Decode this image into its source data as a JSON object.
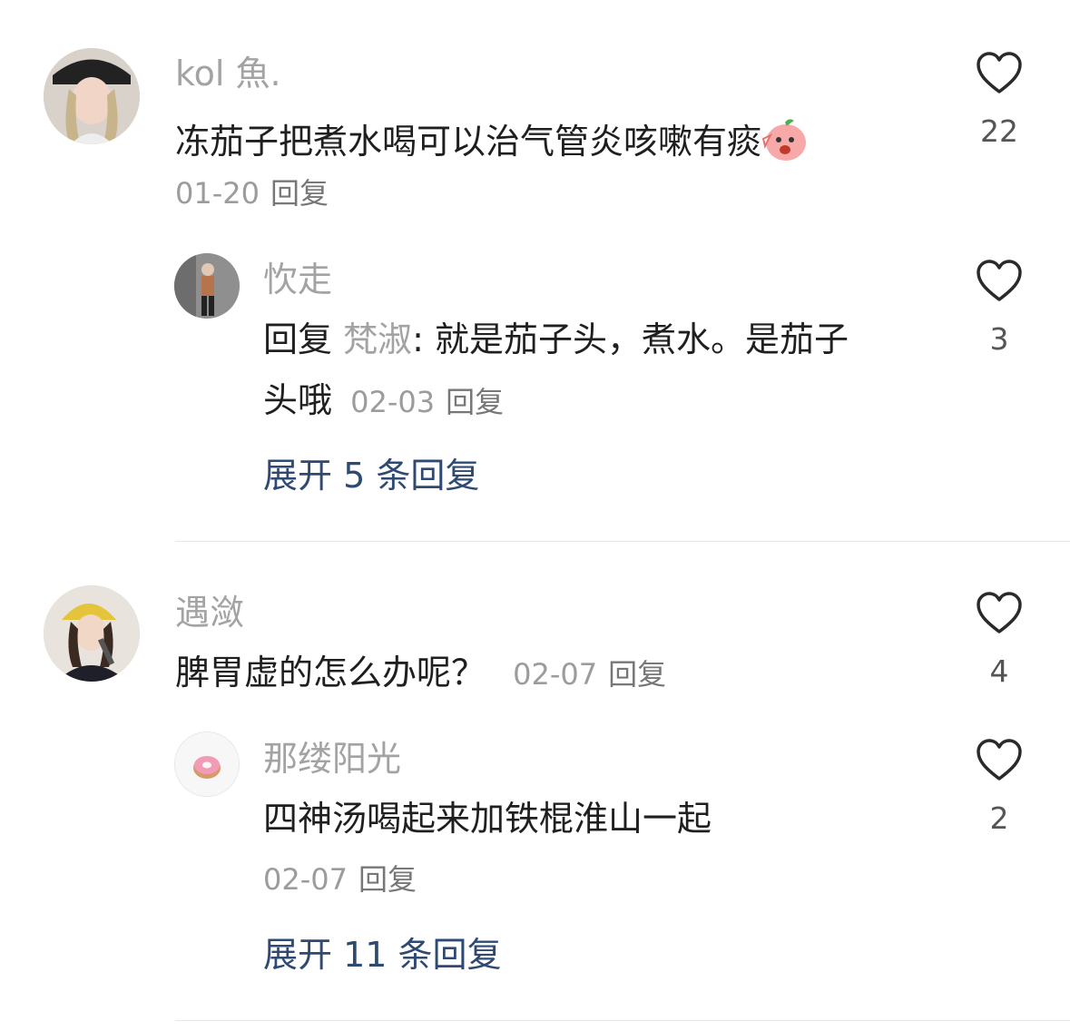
{
  "comments": [
    {
      "username": "kol 魚.",
      "text": "冻茄子把煮水喝可以治气管炎咳嗽有痰",
      "emoji": "face-emoji",
      "date": "01-20",
      "reply_label": "回复",
      "likes": "22",
      "replies": [
        {
          "username": "忺走",
          "reply_prefix": "回复",
          "reply_to": "梵淑",
          "text_line1": ": 就是茄子头，煮水。是茄子",
          "text_line2": "头哦",
          "date": "02-03",
          "reply_label": "回复",
          "likes": "3"
        }
      ],
      "expand_label": "展开 5 条回复"
    },
    {
      "username": "遇潋",
      "text": "脾胃虚的怎么办呢？",
      "date": "02-07",
      "reply_label": "回复",
      "likes": "4",
      "replies": [
        {
          "username": "那缕阳光",
          "text": "四神汤喝起来加铁棍淮山一起",
          "date": "02-07",
          "reply_label": "回复",
          "likes": "2"
        }
      ],
      "expand_label": "展开 11 条回复"
    }
  ],
  "colors": {
    "username": "#a3a3a3",
    "text": "#1f1f1f",
    "expand": "#2e4a73",
    "heart": "#2a2a2a"
  }
}
